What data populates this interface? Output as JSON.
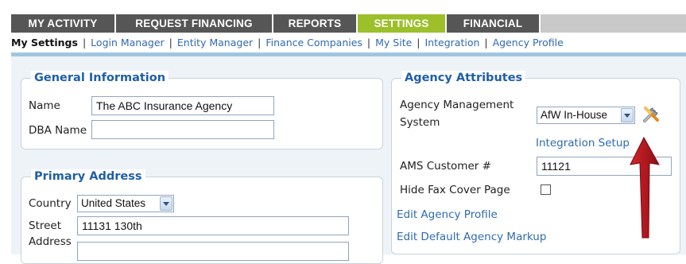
{
  "tabs": [
    {
      "label": "MY ACTIVITY"
    },
    {
      "label": "REQUEST FINANCING"
    },
    {
      "label": "REPORTS"
    },
    {
      "label": "SETTINGS"
    },
    {
      "label": "FINANCIAL"
    }
  ],
  "subnav": {
    "current": "My Settings",
    "separator": "|",
    "links": [
      "Login Manager",
      "Entity Manager",
      "Finance Companies",
      "My Site",
      "Integration",
      "Agency Profile"
    ]
  },
  "general_information": {
    "legend": "General Information",
    "name_label": "Name",
    "name_value": "The ABC Insurance Agency",
    "dba_label": "DBA Name",
    "dba_value": ""
  },
  "primary_address": {
    "legend": "Primary Address",
    "country_label": "Country",
    "country_value": "United States",
    "street_label_1": "Street",
    "street_label_2": "Address",
    "street_value": "11131 130th",
    "street2_value": ""
  },
  "agency_attributes": {
    "legend": "Agency Attributes",
    "ams_label_1": "Agency Management",
    "ams_label_2": "System",
    "ams_value": "AfW In-House",
    "integration_setup": "Integration Setup",
    "customer_label": "AMS Customer #",
    "customer_value": "11121",
    "hide_fax_label": "Hide Fax Cover Page",
    "hide_fax_checked": false,
    "edit_profile": "Edit Agency Profile",
    "edit_markup": "Edit Default Agency Markup"
  },
  "icons": {
    "tools": "tools-icon",
    "annotation_arrow": "red-arrow-icon"
  },
  "colors": {
    "tab_dark": "#565656",
    "tab_active": "#9cbf2a",
    "link": "#2f6bb0",
    "legend": "#1f5fa8",
    "arrow": "#b0141c"
  }
}
